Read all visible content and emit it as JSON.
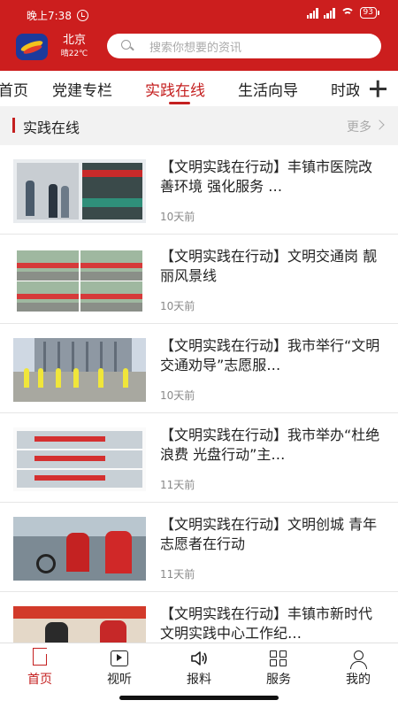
{
  "status_bar": {
    "time": "晚上7:38",
    "battery": "93"
  },
  "header": {
    "city": "北京",
    "weather": "晴22℃",
    "search_placeholder": "搜索你想要的资讯"
  },
  "tabs": [
    {
      "label": "首页"
    },
    {
      "label": "党建专栏"
    },
    {
      "label": "实践在线",
      "active": true
    },
    {
      "label": "生活向导"
    },
    {
      "label": "时政"
    }
  ],
  "section": {
    "title": "实践在线",
    "more": "更多"
  },
  "articles": [
    {
      "title": "【文明实践在行动】丰镇市医院改善环境 强化服务 …",
      "date": "10天前"
    },
    {
      "title": "【文明实践在行动】文明交通岗 靓丽风景线",
      "date": "10天前"
    },
    {
      "title": "【文明实践在行动】我市举行“文明交通劝导”志愿服…",
      "date": "10天前"
    },
    {
      "title": "【文明实践在行动】我市举办“杜绝浪费 光盘行动”主…",
      "date": "11天前"
    },
    {
      "title": "【文明实践在行动】文明创城 青年志愿者在行动",
      "date": "11天前"
    },
    {
      "title": "【文明实践在行动】丰镇市新时代文明实践中心工作纪…",
      "date": ""
    }
  ],
  "bottom_nav": [
    {
      "label": "首页",
      "icon": "home-icon",
      "active": true
    },
    {
      "label": "视听",
      "icon": "video-icon"
    },
    {
      "label": "报料",
      "icon": "speaker-icon"
    },
    {
      "label": "服务",
      "icon": "grid-icon"
    },
    {
      "label": "我的",
      "icon": "user-icon"
    }
  ],
  "colors": {
    "brand_red": "#cc1e1e",
    "active_text": "#c41f1f"
  }
}
